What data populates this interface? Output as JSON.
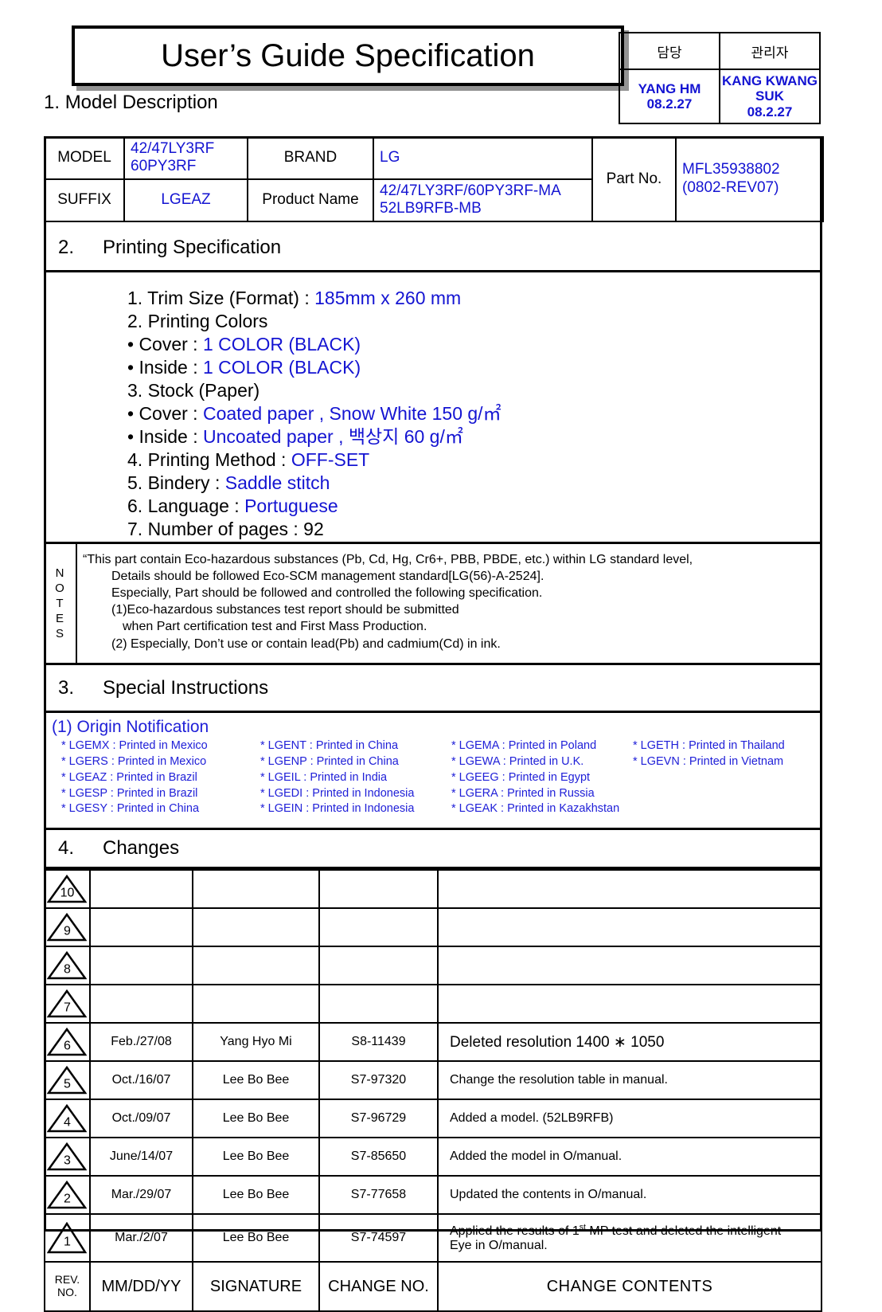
{
  "document": {
    "title": "User’s Guide Specification"
  },
  "approval": {
    "headers": [
      "담당",
      "관리자"
    ],
    "signers": [
      {
        "name": "YANG HM",
        "date": "08.2.27"
      },
      {
        "name": "KANG KWANG SUK",
        "date": "08.2.27"
      }
    ]
  },
  "section1": {
    "number": "1.",
    "title": "Model Description",
    "labels": {
      "model": "MODEL",
      "suffix": "SUFFIX",
      "brand": "BRAND",
      "product_name": "Product Name",
      "part_no": "Part No."
    },
    "values": {
      "model_line1": "42/47LY3RF",
      "model_line2": "60PY3RF",
      "suffix": "LGEAZ",
      "brand": "LG",
      "product_name_line1": "42/47LY3RF/60PY3RF-MA",
      "product_name_line2": "52LB9RFB-MB",
      "part_no_line1": "MFL35938802",
      "part_no_line2": "(0802-REV07)"
    }
  },
  "section2": {
    "number": "2.",
    "title": "Printing Specification",
    "items": [
      {
        "label": "1. Trim Size (Format) : ",
        "value": "185mm x 260 mm"
      },
      {
        "label": "2. Printing Colors",
        "value": ""
      },
      {
        "label": "• Cover : ",
        "value": "1 COLOR (BLACK)"
      },
      {
        "label": "• Inside : ",
        "value": "1 COLOR (BLACK)"
      },
      {
        "label": "3. Stock (Paper)",
        "value": ""
      },
      {
        "label": "• Cover : ",
        "value": "Coated paper , Snow White 150 g/㎡"
      },
      {
        "label": "• Inside : ",
        "value": "Uncoated paper , 백상지 60 g/㎡"
      },
      {
        "label": "4. Printing Method : ",
        "value": "OFF-SET"
      },
      {
        "label": "5. Bindery  : ",
        "value": "Saddle stitch"
      },
      {
        "label": "6. Language : ",
        "value": "Portuguese"
      },
      {
        "label": "7. Number of pages : 92",
        "value": ""
      }
    ]
  },
  "notes": {
    "label_letters": [
      "N",
      "O",
      "T",
      "E",
      "S"
    ],
    "lines": [
      "“This part contain Eco-hazardous substances (Pb, Cd, Hg, Cr6+, PBB, PBDE, etc.) within LG standard level,",
      "Details should be followed Eco-SCM management standard[LG(56)-A-2524].",
      "Especially, Part should be followed and controlled the following specification.",
      "(1)Eco-hazardous substances test report should be submitted",
      "when  Part certification test and First Mass Production.",
      "(2) Especially, Don’t use or contain lead(Pb) and cadmium(Cd) in ink."
    ]
  },
  "section3": {
    "number": "3.",
    "title": "Special Instructions",
    "origin": {
      "title": "(1) Origin Notification",
      "entries": [
        "* LGEMX : Printed in Mexico",
        "* LGENT : Printed in China",
        "* LGEMA : Printed in Poland",
        "* LGETH : Printed in Thailand",
        "* LGERS : Printed in Mexico",
        "* LGENP : Printed in China",
        "* LGEWA : Printed in U.K.",
        "* LGEVN : Printed in Vietnam",
        "* LGEAZ : Printed in Brazil",
        "* LGEIL : Printed in India",
        "* LGEEG : Printed in Egypt",
        "",
        "* LGESP : Printed in Brazil",
        "* LGEDI : Printed in Indonesia",
        "* LGERA : Printed in Russia",
        "",
        "* LGESY : Printed in China",
        "* LGEIN : Printed in Indonesia",
        "* LGEAK : Printed in Kazakhstan",
        ""
      ]
    }
  },
  "section4": {
    "number": "4.",
    "title": "Changes",
    "rows": [
      {
        "rev": "10",
        "date": "",
        "signature": "",
        "change_no": "",
        "contents_line1": "",
        "contents_line2": ""
      },
      {
        "rev": "9",
        "date": "",
        "signature": "",
        "change_no": "",
        "contents_line1": "",
        "contents_line2": ""
      },
      {
        "rev": "8",
        "date": "",
        "signature": "",
        "change_no": "",
        "contents_line1": "",
        "contents_line2": ""
      },
      {
        "rev": "7",
        "date": "",
        "signature": "",
        "change_no": "",
        "contents_line1": "",
        "contents_line2": ""
      },
      {
        "rev": "6",
        "date": "Feb./27/08",
        "signature": "Yang Hyo Mi",
        "change_no": "S8-11439",
        "contents_line1": "Deleted resolution 1400 ∗ 1050",
        "contents_line2": ""
      },
      {
        "rev": "5",
        "date": "Oct./16/07",
        "signature": "Lee Bo Bee",
        "change_no": "S7-97320",
        "contents_line1": "Change the resolution table in manual.",
        "contents_line2": ""
      },
      {
        "rev": "4",
        "date": "Oct./09/07",
        "signature": "Lee Bo Bee",
        "change_no": "S7-96729",
        "contents_line1": "Added a model. (52LB9RFB)",
        "contents_line2": ""
      },
      {
        "rev": "3",
        "date": "June/14/07",
        "signature": "Lee Bo Bee",
        "change_no": "S7-85650",
        "contents_line1": "Added the model in O/manual.",
        "contents_line2": ""
      },
      {
        "rev": "2",
        "date": "Mar./29/07",
        "signature": "Lee Bo Bee",
        "change_no": "S7-77658",
        "contents_line1": "Updated the contents in O/manual.",
        "contents_line2": ""
      },
      {
        "rev": "1",
        "date": "Mar./2/07",
        "signature": "Lee Bo Bee",
        "change_no": "S7-74597",
        "contents_line1": "Applied the results of 1st MP test and deleted the intelligent",
        "contents_line2": "Eye in O/manual."
      }
    ],
    "footer": {
      "rev_no_line1": "REV.",
      "rev_no_line2": "NO.",
      "date": "MM/DD/YY",
      "signature": "SIGNATURE",
      "change_no": "CHANGE NO.",
      "contents": "CHANGE   CONTENTS"
    }
  },
  "colors": {
    "blue": "#1414d2",
    "origin_blue": "#2020d8",
    "black": "#000000"
  }
}
